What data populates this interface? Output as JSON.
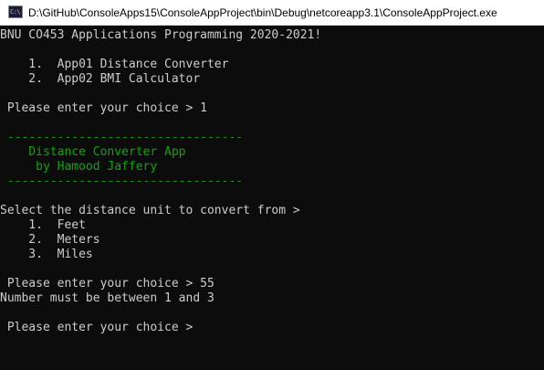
{
  "window": {
    "title": "D:\\GitHub\\ConsoleApps15\\ConsoleAppProject\\bin\\Debug\\netcoreapp3.1\\ConsoleAppProject.exe",
    "icon": "console-app-icon",
    "icon_glyph": "C:\\"
  },
  "console": {
    "header": "BNU CO453 Applications Programming 2020-2021!",
    "menu": [
      "    1.  App01 Distance Converter",
      "    2.  App02 BMI Calculator"
    ],
    "prompt_1": " Please enter your choice > 1",
    "banner": {
      "rule_top": " ---------------------------------",
      "title": "    Distance Converter App",
      "author": "     by Hamood Jaffery",
      "rule_bottom": " ---------------------------------"
    },
    "unit_prompt": "Select the distance unit to convert from >",
    "units": [
      "    1.  Feet",
      "    2.  Meters",
      "    3.  Miles"
    ],
    "prompt_2": " Please enter your choice > 55",
    "error": "Number must be between 1 and 3",
    "prompt_3": " Please enter your choice >"
  },
  "colors": {
    "console_text": "#cccccc",
    "banner_text": "#13a10e",
    "console_background": "#0c0c0c"
  }
}
